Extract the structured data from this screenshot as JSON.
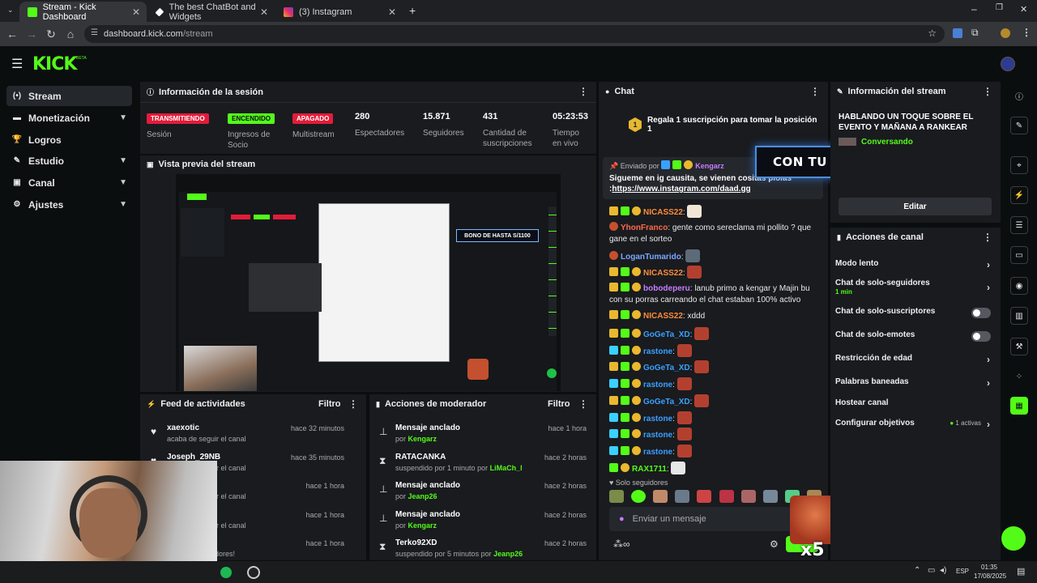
{
  "browser": {
    "tabs": [
      {
        "title": "Stream - Kick Dashboard",
        "icon": "kick-icon",
        "color": "#53fc18"
      },
      {
        "title": "The best ChatBot and Widgets",
        "icon": "botrix-icon",
        "color": "#ffffff"
      },
      {
        "title": "(3) Instagram",
        "icon": "instagram-icon",
        "color": "#e1306c"
      }
    ],
    "url_host": "dashboard.kick.com",
    "url_path": "/stream"
  },
  "app": {
    "logo": "KICK",
    "beta": "BETA",
    "accent": "#53fc18"
  },
  "sidebar": {
    "items": [
      {
        "label": "Stream",
        "icon": "stream-icon"
      },
      {
        "label": "Monetización",
        "icon": "money-icon"
      },
      {
        "label": "Logros",
        "icon": "trophy-icon"
      },
      {
        "label": "Estudio",
        "icon": "studio-icon"
      },
      {
        "label": "Canal",
        "icon": "channel-icon"
      },
      {
        "label": "Ajustes",
        "icon": "settings-icon"
      }
    ]
  },
  "session": {
    "title": "Información de la sesión",
    "badges": [
      {
        "text": "TRANSMITIENDO",
        "label": "Sesión"
      },
      {
        "text": "ENCENDIDO",
        "label": "Ingresos de Socio"
      },
      {
        "text": "APAGADO",
        "label": "Multistream"
      }
    ],
    "stats": [
      {
        "value": "280",
        "label": "Espectadores"
      },
      {
        "value": "15.871",
        "label": "Seguidores"
      },
      {
        "value": "431",
        "label": "Cantidad de suscripciones"
      },
      {
        "value": "05:23:53",
        "label": "Tiempo en vivo"
      }
    ]
  },
  "preview": {
    "title": "Vista previa del stream",
    "banner": "BONO DE HASTA S/1100"
  },
  "feed": {
    "title": "Feed de actividades",
    "filter": "Filtro",
    "items": [
      {
        "name": "xaexotic",
        "detail": "acaba de seguir el canal",
        "time": "hace 32 minutos"
      },
      {
        "name": "Joseph_29NB",
        "detail": "acaba de seguir el canal",
        "time": "hace 35 minutos"
      },
      {
        "name": "",
        "detail": "acaba de seguir el canal",
        "time": "hace 1 hora"
      },
      {
        "name": "",
        "detail": "acaba de seguir el canal",
        "time": "hace 1 hora"
      },
      {
        "name": "",
        "detail": "... 234 espectadores!",
        "time": "hace 1 hora"
      }
    ]
  },
  "moderator": {
    "title": "Acciones de moderador",
    "filter": "Filtro",
    "items": [
      {
        "title": "Mensaje anclado",
        "prefix": "por ",
        "user": "Kengarz",
        "time": "hace 1 hora",
        "icon": "pin-icon"
      },
      {
        "title": "RATACANKA",
        "prefix": "suspendido por 1 minuto por ",
        "user": "LiMaCh_l",
        "time": "hace 2 horas",
        "icon": "hourglass-icon"
      },
      {
        "title": "Mensaje anclado",
        "prefix": "por ",
        "user": "Jeanp26",
        "time": "hace 2 horas",
        "icon": "pin-icon"
      },
      {
        "title": "Mensaje anclado",
        "prefix": "por ",
        "user": "Kengarz",
        "time": "hace 2 horas",
        "icon": "pin-icon"
      },
      {
        "title": "Terko92XD",
        "prefix": "suspendido por 5 minutos por ",
        "user": "Jeanp26",
        "time": "hace 2 horas",
        "icon": "hourglass-icon"
      }
    ]
  },
  "chat": {
    "title": "Chat",
    "gift_text": "Regala 1 suscripción para tomar la posición 1",
    "gift_rank": "1",
    "pinned_by_label": "Enviado por",
    "pinned_by": "Kengarz",
    "pinned_text": "Sigueme en ig causita, se vienen cositas piolas :",
    "pinned_link": "https://www.instagram.com/daad.gg",
    "messages": [
      {
        "user": "NICASS22",
        "color": "#ff8c3a",
        "text": ":"
      },
      {
        "user": "YhonFranco",
        "color": "#ff6a4a",
        "text": ": gente como sereclama mi pollito ? que gane en el sorteo"
      },
      {
        "user": "LoganTumarido",
        "color": "#7aa7ff",
        "text": ":"
      },
      {
        "user": "NICASS22",
        "color": "#ff8c3a",
        "text": ":"
      },
      {
        "user": "bobodeperu",
        "color": "#c77dff",
        "text": ": lanub primo a kengar y Majin bu con su porras carreando el chat estaban 100% activo"
      },
      {
        "user": "NICASS22",
        "color": "#ff8c3a",
        "text": ": xddd"
      },
      {
        "user": "GoGeTa_XD",
        "color": "#3aa0ff",
        "text": ":"
      },
      {
        "user": "rastone",
        "color": "#3aa0ff",
        "text": ":"
      },
      {
        "user": "GoGeTa_XD",
        "color": "#3aa0ff",
        "text": ":"
      },
      {
        "user": "rastone",
        "color": "#3aa0ff",
        "text": ":"
      },
      {
        "user": "GoGeTa_XD",
        "color": "#3aa0ff",
        "text": ":"
      },
      {
        "user": "rastone",
        "color": "#3aa0ff",
        "text": ":"
      },
      {
        "user": "rastone",
        "color": "#3aa0ff",
        "text": ":"
      },
      {
        "user": "rastone",
        "color": "#3aa0ff",
        "text": ":"
      },
      {
        "user": "RAX1711",
        "color": "#53fc18",
        "text": ":"
      }
    ],
    "followers_only": "Solo seguidores",
    "input_placeholder": "Enviar un mensaje",
    "overlay_banner": "CON TU PRIMER DEPÓSITO",
    "multiplier": "x5"
  },
  "stream_info": {
    "title": "Información del stream",
    "stream_title": "HABLANDO UN TOQUE SOBRE EL EVENTO Y MAÑANA A RANKEAR",
    "category": "Conversando",
    "edit_label": "Editar"
  },
  "channel_actions": {
    "title": "Acciones de canal",
    "items": [
      {
        "label": "Modo lento",
        "type": "arrow",
        "sub": ""
      },
      {
        "label": "Chat de solo-seguidores",
        "type": "arrow",
        "sub": "1 min"
      },
      {
        "label": "Chat de solo-suscriptores",
        "type": "toggle",
        "sub": ""
      },
      {
        "label": "Chat de solo-emotes",
        "type": "toggle",
        "sub": ""
      },
      {
        "label": "Restricción de edad",
        "type": "arrow",
        "sub": ""
      },
      {
        "label": "Palabras baneadas",
        "type": "arrow",
        "sub": ""
      },
      {
        "label": "Hostear canal",
        "type": "none",
        "sub": ""
      },
      {
        "label": "Configurar objetivos",
        "type": "arrow",
        "sub": "1 activas"
      }
    ]
  },
  "taskbar": {
    "lang": "ESP",
    "time": "01:35",
    "date": "17/08/2025"
  }
}
